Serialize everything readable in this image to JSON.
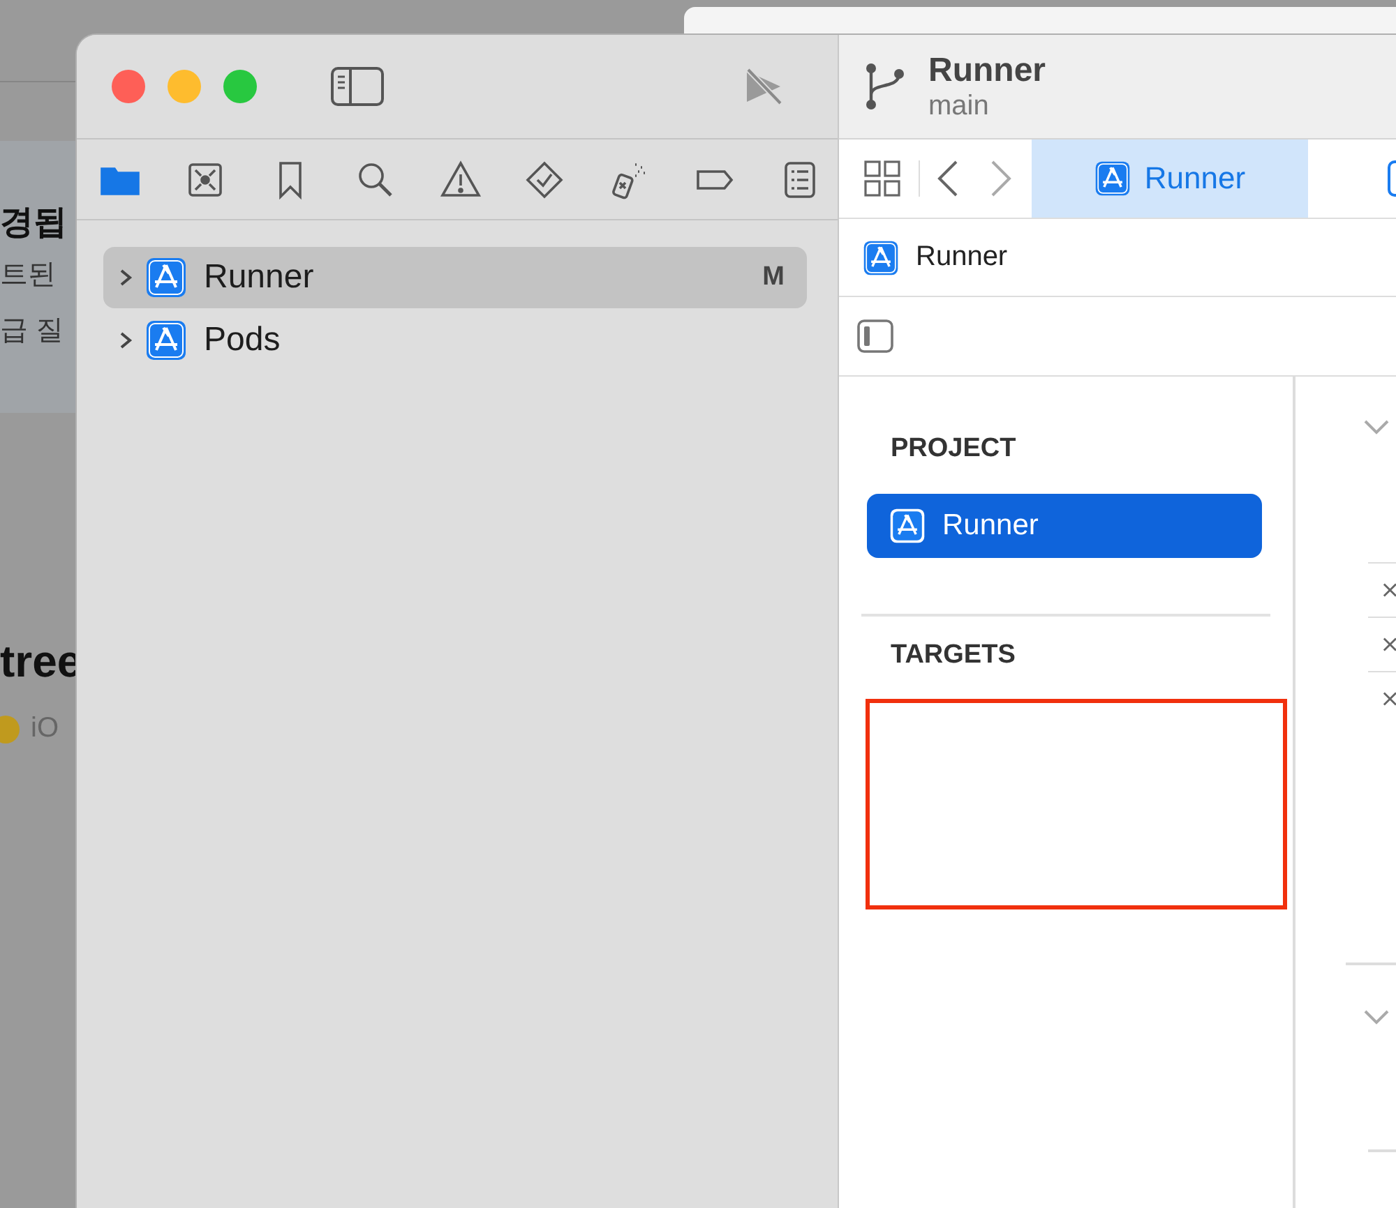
{
  "background_page": {
    "heading": "경됩",
    "lines": [
      "트된",
      "급 질"
    ],
    "title": "tree",
    "meta": "iO"
  },
  "navigator": {
    "tabs": [
      {
        "kind": "folder",
        "selected": true
      },
      {
        "kind": "source-control",
        "selected": false
      },
      {
        "kind": "bookmark",
        "selected": false
      },
      {
        "kind": "search",
        "selected": false
      },
      {
        "kind": "warning",
        "selected": false
      },
      {
        "kind": "test",
        "selected": false
      },
      {
        "kind": "debug",
        "selected": false
      },
      {
        "kind": "breakpoint",
        "selected": false
      },
      {
        "kind": "report",
        "selected": false
      }
    ],
    "tree": [
      {
        "label": "Runner",
        "badge": "M",
        "selected": true,
        "expanded": false
      },
      {
        "label": "Pods",
        "selected": false,
        "expanded": false
      }
    ]
  },
  "editor": {
    "scheme": {
      "title": "Runner",
      "branch": "main"
    },
    "tabs": [
      {
        "label": "Runner",
        "selected": true
      }
    ],
    "jump_bar": [
      "Runner"
    ],
    "sections": [
      {
        "heading": "PROJECT",
        "items": [
          {
            "label": "Runner",
            "selected": true
          }
        ]
      },
      {
        "heading": "TARGETS"
      }
    ]
  }
}
